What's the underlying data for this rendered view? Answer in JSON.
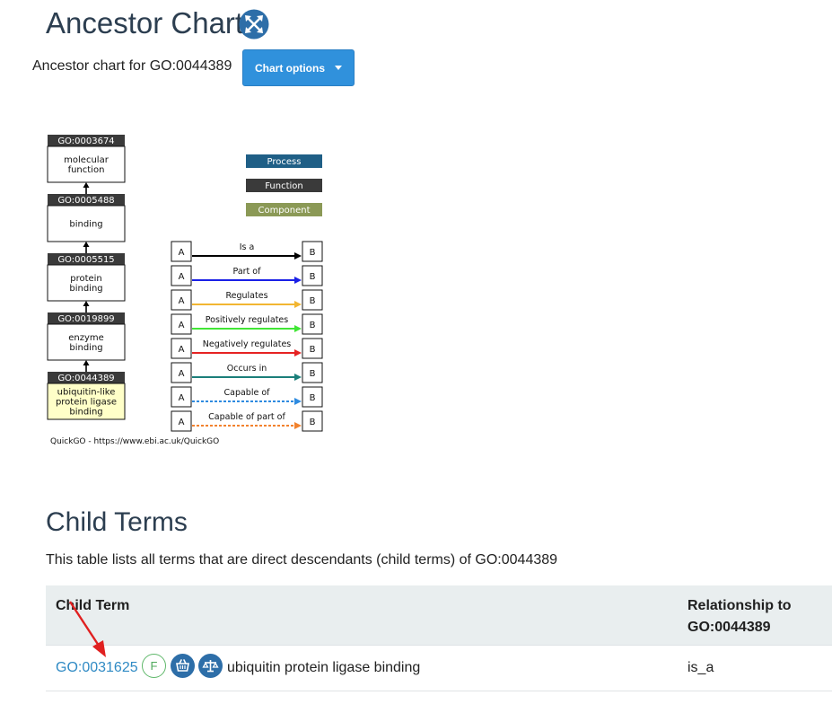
{
  "header": {
    "title": "Ancestor Chart",
    "subtitle": "Ancestor chart for GO:0044389",
    "chart_options_label": "Chart options"
  },
  "chart": {
    "nodes": [
      {
        "id": "GO:0003674",
        "line1": "molecular",
        "line2": "function",
        "line3": ""
      },
      {
        "id": "GO:0005488",
        "line1": "binding",
        "line2": "",
        "line3": ""
      },
      {
        "id": "GO:0005515",
        "line1": "protein",
        "line2": "binding",
        "line3": ""
      },
      {
        "id": "GO:0019899",
        "line1": "enzyme",
        "line2": "binding",
        "line3": ""
      },
      {
        "id": "GO:0044389",
        "line1": "ubiquitin-like",
        "line2": "protein ligase",
        "line3": "binding"
      }
    ],
    "aspect_legend": [
      {
        "label": "Process",
        "color": "#1f5f86"
      },
      {
        "label": "Function",
        "color": "#3a3a3a"
      },
      {
        "label": "Component",
        "color": "#8b9956"
      }
    ],
    "relation_legend": [
      {
        "label": "Is a",
        "color": "#000000",
        "dashed": false
      },
      {
        "label": "Part of",
        "color": "#1a20e6",
        "dashed": false
      },
      {
        "label": "Regulates",
        "color": "#f2b632",
        "dashed": false
      },
      {
        "label": "Positively regulates",
        "color": "#41e636",
        "dashed": false
      },
      {
        "label": "Negatively regulates",
        "color": "#e62323",
        "dashed": false
      },
      {
        "label": "Occurs in",
        "color": "#1b7f7a",
        "dashed": false
      },
      {
        "label": "Capable of",
        "color": "#2e8be0",
        "dashed": true
      },
      {
        "label": "Capable of part of",
        "color": "#f2822e",
        "dashed": true
      }
    ],
    "box_a": "A",
    "box_b": "B",
    "footer": "QuickGO - https://www.ebi.ac.uk/QuickGO"
  },
  "child_terms": {
    "heading": "Child Terms",
    "description": "This table lists all terms that are direct descendants (child terms) of GO:0044389",
    "columns": [
      "Child Term",
      "Relationship to GO:0044389"
    ],
    "rows": [
      {
        "go_id": "GO:0031625",
        "aspect_badge": "F",
        "name": "ubiquitin protein ligase binding",
        "relationship": "is_a"
      }
    ]
  },
  "colors": {
    "heading": "#2c3e50",
    "button": "#3091dc",
    "link": "#2f8ac4",
    "annotation_arrow": "#e02020"
  },
  "icons": [
    "expand-arrows-icon",
    "basket-icon",
    "balance-scale-icon",
    "annotation-arrow"
  ]
}
